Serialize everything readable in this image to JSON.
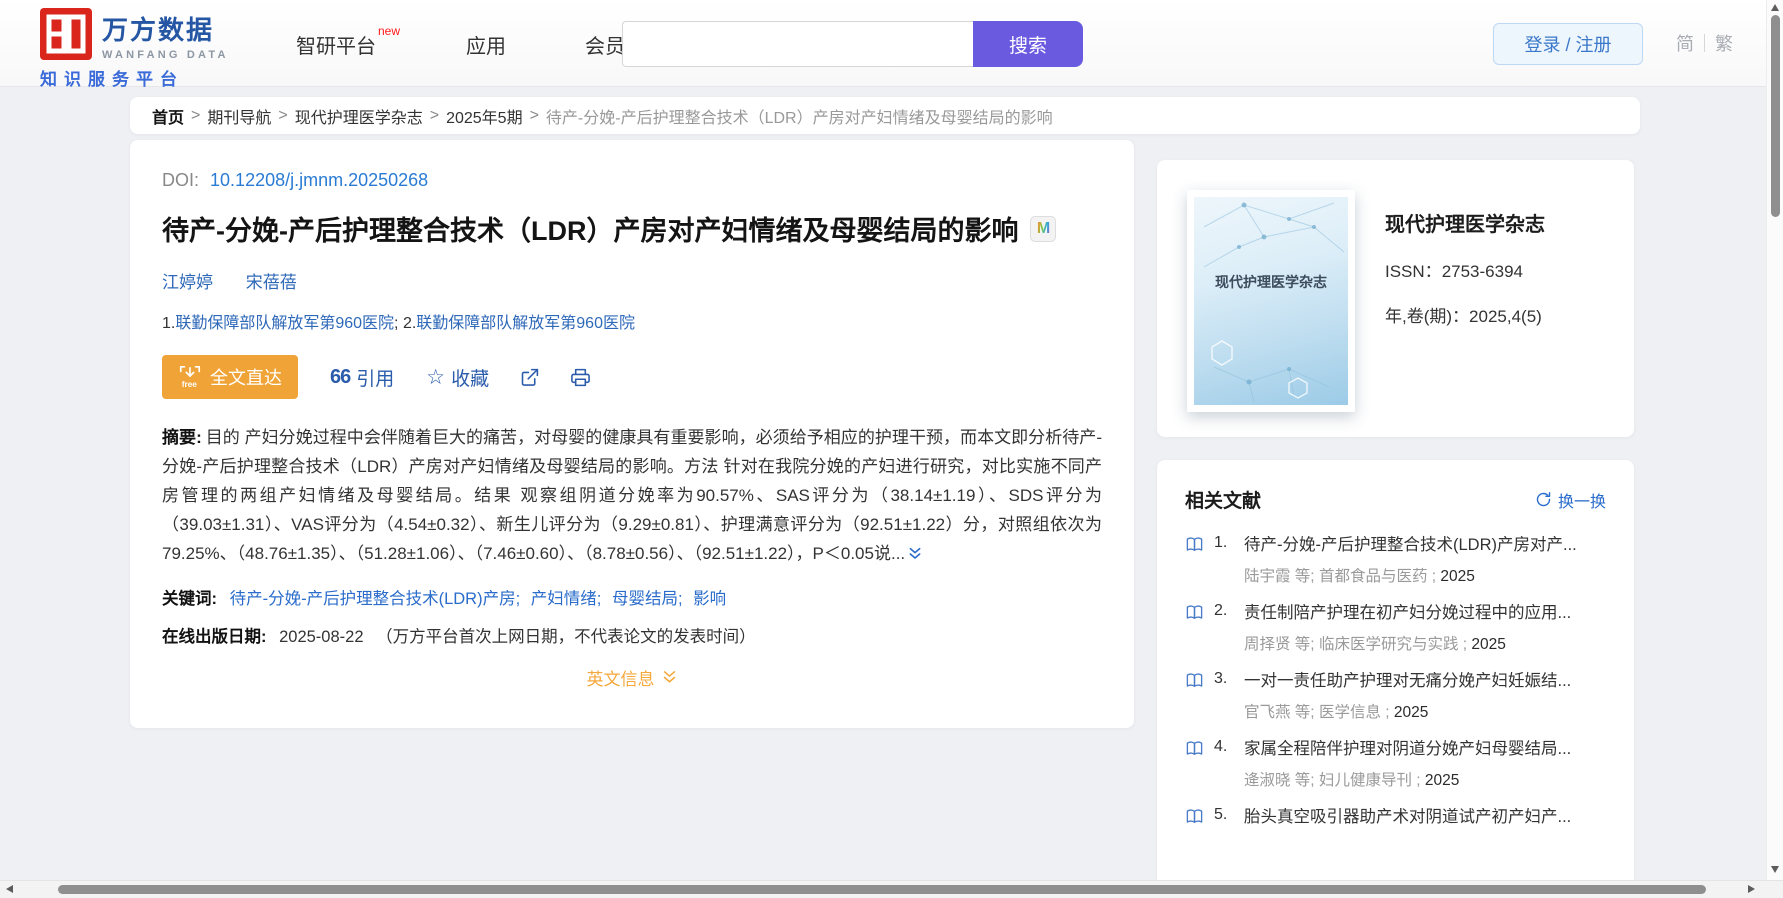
{
  "header": {
    "brand": "万方数据",
    "brand_en": "WANFANG DATA",
    "tagline": "知识服务平台",
    "nav": [
      {
        "label": "智研平台",
        "badge": "new"
      },
      {
        "label": "应用"
      },
      {
        "label": "会员"
      }
    ],
    "search_button": "搜索",
    "login_button": "登录 / 注册",
    "lang_simplified": "简",
    "lang_traditional": "繁"
  },
  "breadcrumb": {
    "separator": ">",
    "links": [
      "首页",
      "期刊导航",
      "现代护理医学杂志",
      "2025年5期"
    ],
    "current": "待产-分娩-产后护理整合技术（LDR）产房对产妇情绪及母婴结局的影响"
  },
  "article": {
    "doi_label": "DOI:",
    "doi": "10.12208/j.jmnm.20250268",
    "title": "待产-分娩-产后护理整合技术（LDR）产房对产妇情绪及母婴结局的影响",
    "title_badge": "M",
    "authors": [
      "江婷婷",
      "宋蓓蓓"
    ],
    "affiliation_1_num": "1.",
    "affiliation_1": "联勤保障部队解放军第960医院",
    "affiliation_sep": "; ",
    "affiliation_2_num": "2.",
    "affiliation_2": "联勤保障部队解放军第960医院",
    "fulltext_button": "全文直达",
    "fulltext_icon_text": "free",
    "cite_icon_text": "66",
    "cite_label": "引用",
    "favorite_icon": "☆",
    "favorite_label": "收藏",
    "abstract_label": "摘要:",
    "abstract": "目的 产妇分娩过程中会伴随着巨大的痛苦，对母婴的健康具有重要影响，必须给予相应的护理干预，而本文即分析待产-分娩-产后护理整合技术（LDR）产房对产妇情绪及母婴结局的影响。方法 针对在我院分娩的产妇进行研究，对比实施不同产房管理的两组产妇情绪及母婴结局。结果 观察组阴道分娩率为90.57%、SAS评分为（38.14±1.19）、SDS评分为（39.03±1.31）、VAS评分为（4.54±0.32）、新生儿评分为（9.29±0.81）、护理满意评分为（92.51±1.22）分，对照组依次为79.25%、（48.76±1.35）、（51.28±1.06）、（7.46±0.60）、（8.78±0.56）、（92.51±1.22），P＜0.05说...",
    "keywords_label": "关键词:",
    "keywords": [
      "待产-分娩-产后护理整合技术(LDR)产房;",
      "产妇情绪;",
      "母婴结局;",
      "影响"
    ],
    "online_date_label": "在线出版日期:",
    "online_date": "2025-08-22",
    "online_date_note": "（万方平台首次上网日期，不代表论文的发表时间）",
    "english_toggle": "英文信息"
  },
  "journal": {
    "cover_text": "现代护理医学杂志",
    "name": "现代护理医学杂志",
    "issn_label": "ISSN：",
    "issn": "2753-6394",
    "volume_label": "年,卷(期)：",
    "volume": "2025,4(5)"
  },
  "related": {
    "title": "相关文献",
    "refresh_label": "换一换",
    "items": [
      {
        "num": "1.",
        "title": "待产-分娩-产后护理整合技术(LDR)产房对产...",
        "author": "陆宇霞  等;",
        "source": "首都食品与医药 ;",
        "year": "2025"
      },
      {
        "num": "2.",
        "title": "责任制陪产护理在初产妇分娩过程中的应用...",
        "author": "周择贤  等;",
        "source": "临床医学研究与实践 ;",
        "year": "2025"
      },
      {
        "num": "3.",
        "title": "一对一责任助产护理对无痛分娩产妇妊娠结...",
        "author": "官飞燕  等;",
        "source": "医学信息 ;",
        "year": "2025"
      },
      {
        "num": "4.",
        "title": "家属全程陪伴护理对阴道分娩产妇母婴结局...",
        "author": "逄淑晓  等;",
        "source": "妇儿健康导刊 ;",
        "year": "2025"
      },
      {
        "num": "5.",
        "title": "胎头真空吸引器助产术对阴道试产初产妇产..."
      }
    ]
  },
  "colors": {
    "accent_purple": "#6a5ae0",
    "link_blue": "#2a6ccb",
    "brand_red": "#da251c",
    "brand_blue": "#2456a4",
    "orange_button": "#f0a438"
  }
}
